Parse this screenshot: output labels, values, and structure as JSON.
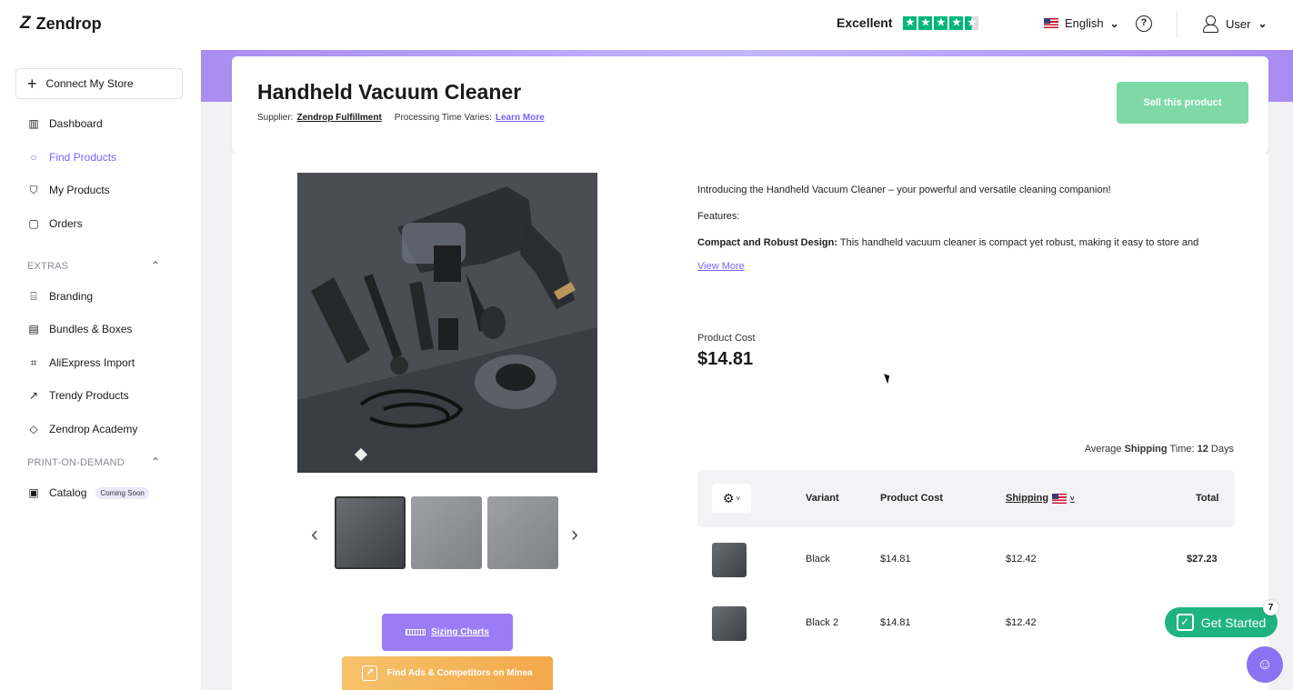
{
  "brand": {
    "name": "Zendrop",
    "logo_icon": "zendrop-z-logo"
  },
  "header": {
    "rating_label": "Excellent",
    "rating_stars": 4.5,
    "language": "English",
    "help_glyph": "?",
    "user_label": "User",
    "chevron": "⌄"
  },
  "sidebar": {
    "connect_label": "Connect My Store",
    "items": [
      {
        "label": "Dashboard",
        "icon": "bar-chart-icon"
      },
      {
        "label": "Find Products",
        "icon": "search-icon",
        "active": true
      },
      {
        "label": "My Products",
        "icon": "shirt-icon"
      },
      {
        "label": "Orders",
        "icon": "clipboard-icon"
      }
    ],
    "extras_label": "EXTRAS",
    "extras": [
      {
        "label": "Branding",
        "icon": "branding-icon"
      },
      {
        "label": "Bundles & Boxes",
        "icon": "box-icon"
      },
      {
        "label": "AliExpress Import",
        "icon": "import-icon"
      },
      {
        "label": "Trendy Products",
        "icon": "trend-chart-icon"
      },
      {
        "label": "Zendrop Academy",
        "icon": "graduation-cap-icon"
      }
    ],
    "pod_label": "PRINT-ON-DEMAND",
    "pod": [
      {
        "label": "Catalog",
        "icon": "image-icon",
        "badge": "Coming Soon"
      }
    ]
  },
  "product": {
    "title": "Handheld Vacuum Cleaner",
    "supplier_prefix": "Supplier:",
    "supplier_name": "Zendrop Fulfillment",
    "processing_text": "Processing Time Varies:",
    "learn_more": "Learn More",
    "sell_button": "Sell this product",
    "intro": "Introducing the  Handheld Vacuum Cleaner – your powerful and versatile cleaning companion!",
    "features_label": "Features:",
    "feature_bold": "Compact and Robust Design:",
    "feature_text": " This handheld vacuum cleaner is compact yet robust, making it easy to store and",
    "view_more": "View More",
    "cost_label": "Product Cost",
    "cost_value": "$14.81",
    "shipping_note_prefix": "Average ",
    "shipping_note_bold": "Shipping",
    "shipping_note_mid": " Time: ",
    "shipping_days": "12",
    "shipping_note_suffix": " Days",
    "sizing_button": "Sizing Charts",
    "minea_button": "Find Ads & Competitors on Minea"
  },
  "table": {
    "headers": {
      "variant": "Variant",
      "cost": "Product Cost",
      "shipping": "Shipping",
      "total": "Total"
    },
    "rows": [
      {
        "variant": "Black",
        "cost": "$14.81",
        "shipping": "$12.42",
        "total": "$27.23"
      },
      {
        "variant": "Black 2",
        "cost": "$14.81",
        "shipping": "$12.42",
        "total": ""
      }
    ]
  },
  "widgets": {
    "get_started": "Get Started",
    "get_started_count": "7"
  },
  "colors": {
    "accent": "#7b61ff",
    "success": "#1fb380",
    "sell_button": "#7fd9a6",
    "band": "#b7a2f7"
  }
}
